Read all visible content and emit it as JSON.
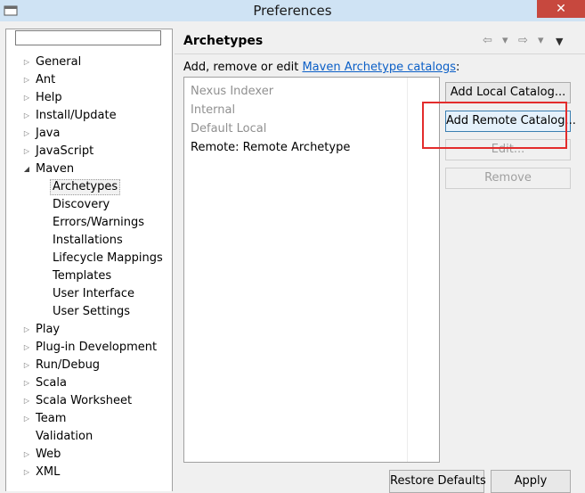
{
  "window": {
    "title": "Preferences",
    "close_glyph": "✕"
  },
  "filter": {
    "value": "",
    "placeholder": ""
  },
  "tree": [
    {
      "label": "General",
      "arrow": "▷"
    },
    {
      "label": "Ant",
      "arrow": "▷"
    },
    {
      "label": "Help",
      "arrow": "▷"
    },
    {
      "label": "Install/Update",
      "arrow": "▷"
    },
    {
      "label": "Java",
      "arrow": "▷"
    },
    {
      "label": "JavaScript",
      "arrow": "▷"
    },
    {
      "label": "Maven",
      "arrow": "◢"
    },
    {
      "label": "Archetypes",
      "arrow": ""
    },
    {
      "label": "Discovery",
      "arrow": ""
    },
    {
      "label": "Errors/Warnings",
      "arrow": ""
    },
    {
      "label": "Installations",
      "arrow": ""
    },
    {
      "label": "Lifecycle Mappings",
      "arrow": ""
    },
    {
      "label": "Templates",
      "arrow": ""
    },
    {
      "label": "User Interface",
      "arrow": ""
    },
    {
      "label": "User Settings",
      "arrow": ""
    },
    {
      "label": "Play",
      "arrow": "▷"
    },
    {
      "label": "Plug-in Development",
      "arrow": "▷"
    },
    {
      "label": "Run/Debug",
      "arrow": "▷"
    },
    {
      "label": "Scala",
      "arrow": "▷"
    },
    {
      "label": "Scala Worksheet",
      "arrow": "▷"
    },
    {
      "label": "Team",
      "arrow": "▷"
    },
    {
      "label": "Validation",
      "arrow": ""
    },
    {
      "label": "Web",
      "arrow": "▷"
    },
    {
      "label": "XML",
      "arrow": "▷"
    }
  ],
  "page": {
    "title": "Archetypes",
    "desc_prefix": "Add, remove or edit ",
    "desc_link": "Maven Archetype catalogs",
    "desc_suffix": ":",
    "nav": {
      "back": "⇦",
      "dropdown": "▾",
      "forward": "⇨",
      "menu": "▼"
    }
  },
  "catalogs": [
    {
      "label": "Nexus Indexer"
    },
    {
      "label": "Internal"
    },
    {
      "label": "Default Local"
    },
    {
      "label": "Remote: Remote Archetype"
    }
  ],
  "buttons": {
    "add_local": "Add Local Catalog...",
    "add_remote": "Add Remote Catalog...",
    "edit": "Edit...",
    "remove": "Remove",
    "restore_defaults": "Restore Defaults",
    "apply": "Apply"
  }
}
